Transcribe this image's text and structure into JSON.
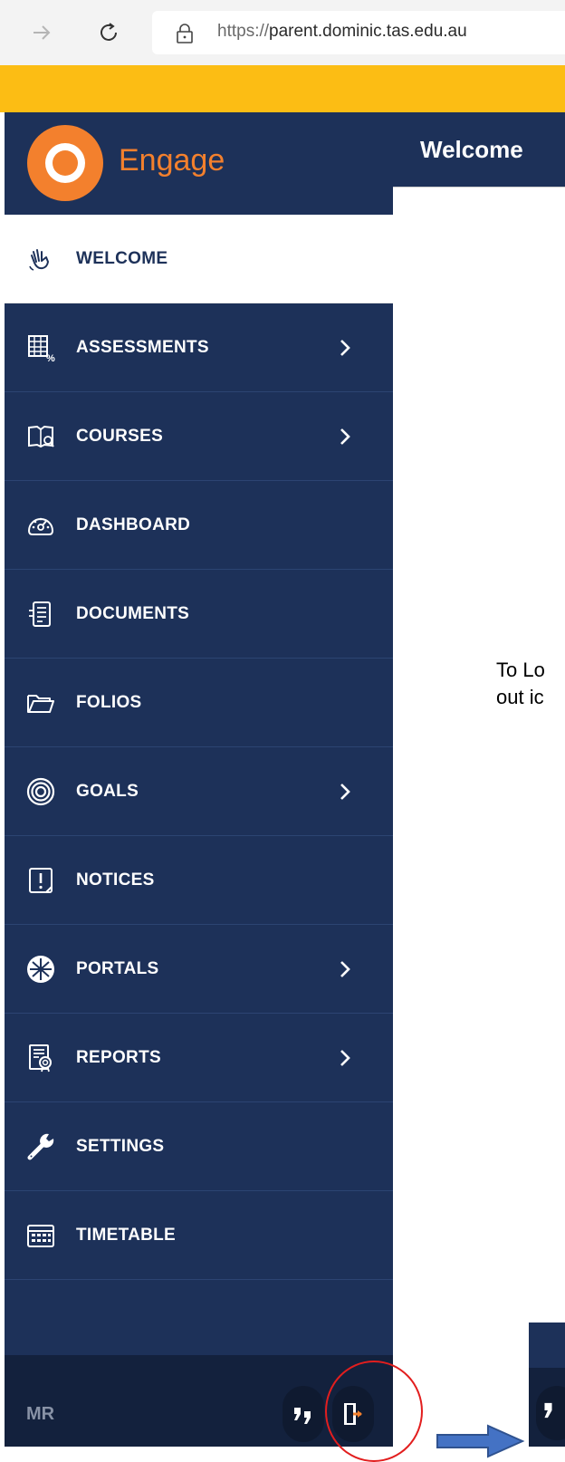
{
  "browser": {
    "url_protocol": "https://",
    "url_host": "parent.dominic.tas.edu.au"
  },
  "brand": {
    "name": "Engage"
  },
  "sidebar": {
    "items": [
      {
        "label": "WELCOME",
        "icon": "hand-wave-icon",
        "active": true,
        "has_submenu": false
      },
      {
        "label": "ASSESSMENTS",
        "icon": "grid-percent-icon",
        "active": false,
        "has_submenu": true
      },
      {
        "label": "COURSES",
        "icon": "book-search-icon",
        "active": false,
        "has_submenu": true
      },
      {
        "label": "DASHBOARD",
        "icon": "speedometer-icon",
        "active": false,
        "has_submenu": false
      },
      {
        "label": "DOCUMENTS",
        "icon": "document-icon",
        "active": false,
        "has_submenu": false
      },
      {
        "label": "FOLIOS",
        "icon": "folder-icon",
        "active": false,
        "has_submenu": false
      },
      {
        "label": "GOALS",
        "icon": "target-icon",
        "active": false,
        "has_submenu": true
      },
      {
        "label": "NOTICES",
        "icon": "notice-icon",
        "active": false,
        "has_submenu": false
      },
      {
        "label": "PORTALS",
        "icon": "portal-icon",
        "active": false,
        "has_submenu": true
      },
      {
        "label": "REPORTS",
        "icon": "report-icon",
        "active": false,
        "has_submenu": true
      },
      {
        "label": "SETTINGS",
        "icon": "wrench-icon",
        "active": false,
        "has_submenu": false
      },
      {
        "label": "TIMETABLE",
        "icon": "timetable-icon",
        "active": false,
        "has_submenu": false
      }
    ],
    "footer": {
      "initials": "MR",
      "buttons": [
        "quote-icon",
        "logout-icon"
      ]
    }
  },
  "main": {
    "title": "Welcome",
    "instruction_line1": "To Lo",
    "instruction_line2": "out ic"
  },
  "colors": {
    "sidebar_bg": "#1d3159",
    "accent_orange": "#f3802d",
    "notice_yellow": "#fcbd14",
    "annotation_red": "#e21e1e",
    "annotation_arrow": "#4472c4"
  }
}
